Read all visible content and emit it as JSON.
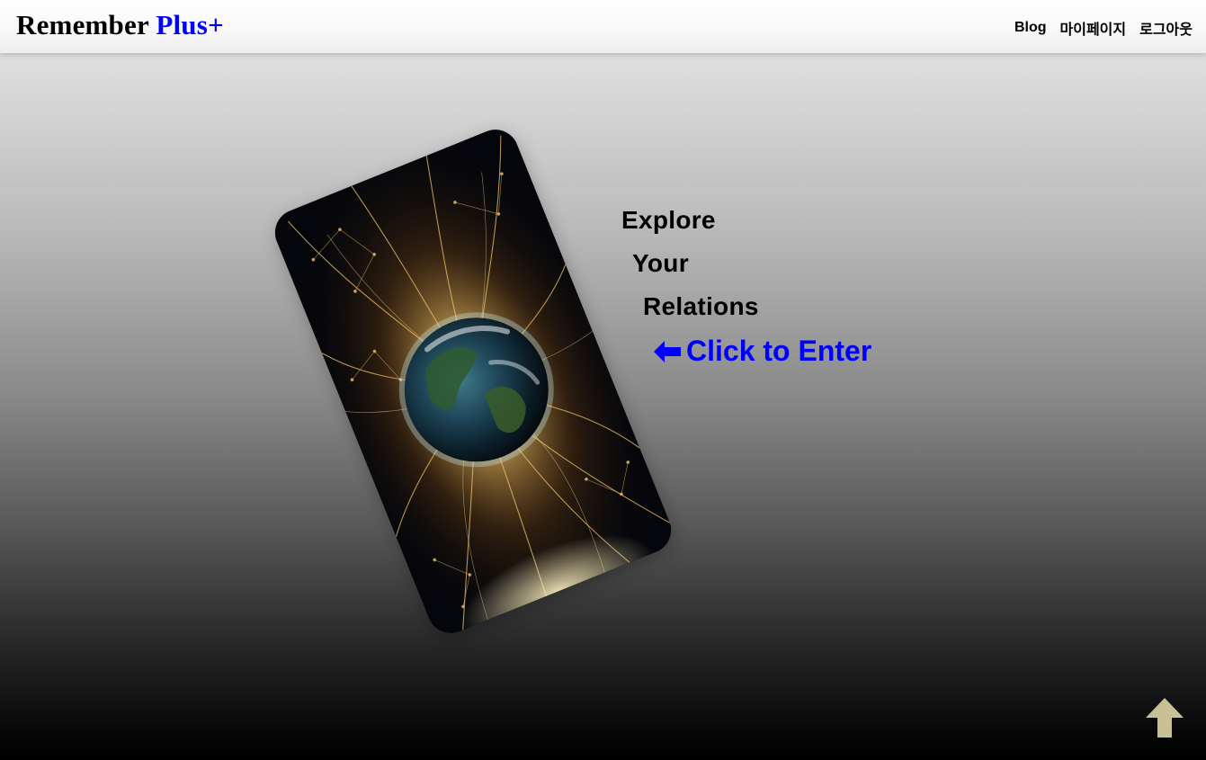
{
  "header": {
    "logo_main": "Remember ",
    "logo_plus": "Plus+",
    "nav": [
      {
        "label": "Blog"
      },
      {
        "label": "마이페이지"
      },
      {
        "label": "로그아웃"
      }
    ]
  },
  "hero": {
    "words": [
      "Explore",
      "Your",
      "Relations"
    ],
    "cta_label": "Click to Enter",
    "cta_icon": "arrow-left-icon",
    "card_image": "earth-network-icon"
  },
  "scroll_top": {
    "icon": "arrow-up-icon"
  },
  "colors": {
    "accent": "#0000ff",
    "text": "#000000",
    "scroll_top": "#c9c196"
  }
}
